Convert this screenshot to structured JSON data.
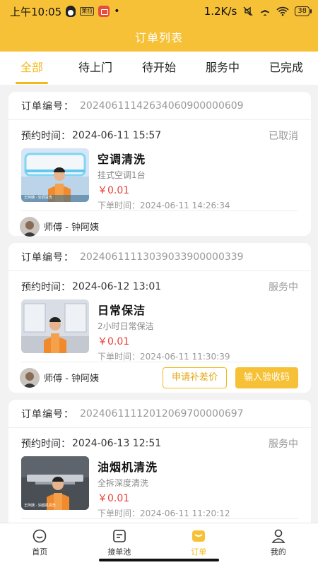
{
  "status_bar": {
    "time": "上午10:05",
    "small_label": "莱拉",
    "dot": "•",
    "speed": "1.2K/s",
    "battery": "38"
  },
  "header": {
    "title": "订单列表"
  },
  "tabs": [
    {
      "label": "全部",
      "active": true
    },
    {
      "label": "待上门",
      "active": false
    },
    {
      "label": "待开始",
      "active": false
    },
    {
      "label": "服务中",
      "active": false
    },
    {
      "label": "已完成",
      "active": false
    }
  ],
  "orders": [
    {
      "order_label": "订单编号：",
      "order_no": "20240611142634060900000609",
      "appt_label": "预约时间：",
      "appt_time": "2024-06-11 15:57",
      "status": "已取消",
      "service_name": "空调清洗",
      "service_desc": "挂式空调1台",
      "price": "￥0.01",
      "order_time_label": "下单时间：",
      "order_time": "2024-06-11 14:26:34",
      "thumb_caption": "王阿姨 · 空调清洗",
      "worker": "师傅 - 钟阿姨",
      "buttons": []
    },
    {
      "order_label": "订单编号：",
      "order_no": "20240611113039033900000339",
      "appt_label": "预约时间：",
      "appt_time": "2024-06-12 13:01",
      "status": "服务中",
      "service_name": "日常保洁",
      "service_desc": "2小时日常保洁",
      "price": "￥0.01",
      "order_time_label": "下单时间：",
      "order_time": "2024-06-11 11:30:39",
      "thumb_caption": "",
      "worker": "师傅 - 钟阿姨",
      "buttons": [
        "申请补差价",
        "输入验收码"
      ]
    },
    {
      "order_label": "订单编号：",
      "order_no": "20240611112012069700000697",
      "appt_label": "预约时间：",
      "appt_time": "2024-06-13 12:51",
      "status": "服务中",
      "service_name": "油烟机清洗",
      "service_desc": "全拆深度清洗",
      "price": "￥0.01",
      "order_time_label": "下单时间：",
      "order_time": "2024-06-11 11:20:12",
      "thumb_caption": "王阿姨 · 油烟机清洗",
      "worker": "",
      "buttons": []
    }
  ],
  "bottom_nav": [
    {
      "label": "首页",
      "icon": "home-icon",
      "active": false
    },
    {
      "label": "接单池",
      "icon": "pool-icon",
      "active": false
    },
    {
      "label": "订单",
      "icon": "order-icon",
      "active": true
    },
    {
      "label": "我的",
      "icon": "profile-icon",
      "active": false
    }
  ],
  "colors": {
    "accent": "#f7c137",
    "price": "#e8413b"
  }
}
